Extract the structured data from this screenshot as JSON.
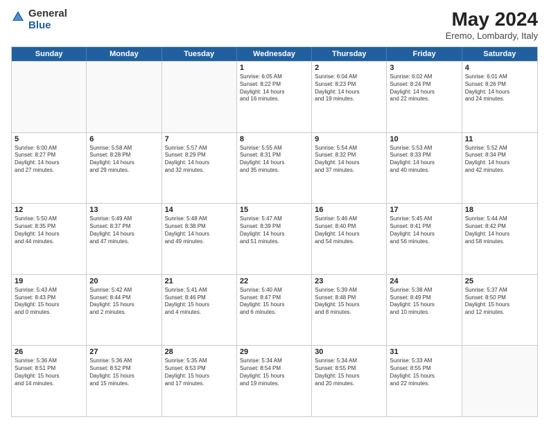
{
  "logo": {
    "general": "General",
    "blue": "Blue"
  },
  "title": "May 2024",
  "subtitle": "Eremo, Lombardy, Italy",
  "header_days": [
    "Sunday",
    "Monday",
    "Tuesday",
    "Wednesday",
    "Thursday",
    "Friday",
    "Saturday"
  ],
  "rows": [
    [
      {
        "day": "",
        "info": ""
      },
      {
        "day": "",
        "info": ""
      },
      {
        "day": "",
        "info": ""
      },
      {
        "day": "1",
        "info": "Sunrise: 6:05 AM\nSunset: 8:22 PM\nDaylight: 14 hours\nand 16 minutes."
      },
      {
        "day": "2",
        "info": "Sunrise: 6:04 AM\nSunset: 8:23 PM\nDaylight: 14 hours\nand 19 minutes."
      },
      {
        "day": "3",
        "info": "Sunrise: 6:02 AM\nSunset: 8:24 PM\nDaylight: 14 hours\nand 22 minutes."
      },
      {
        "day": "4",
        "info": "Sunrise: 6:01 AM\nSunset: 8:26 PM\nDaylight: 14 hours\nand 24 minutes."
      }
    ],
    [
      {
        "day": "5",
        "info": "Sunrise: 6:00 AM\nSunset: 8:27 PM\nDaylight: 14 hours\nand 27 minutes."
      },
      {
        "day": "6",
        "info": "Sunrise: 5:58 AM\nSunset: 8:28 PM\nDaylight: 14 hours\nand 29 minutes."
      },
      {
        "day": "7",
        "info": "Sunrise: 5:57 AM\nSunset: 8:29 PM\nDaylight: 14 hours\nand 32 minutes."
      },
      {
        "day": "8",
        "info": "Sunrise: 5:55 AM\nSunset: 8:31 PM\nDaylight: 14 hours\nand 35 minutes."
      },
      {
        "day": "9",
        "info": "Sunrise: 5:54 AM\nSunset: 8:32 PM\nDaylight: 14 hours\nand 37 minutes."
      },
      {
        "day": "10",
        "info": "Sunrise: 5:53 AM\nSunset: 8:33 PM\nDaylight: 14 hours\nand 40 minutes."
      },
      {
        "day": "11",
        "info": "Sunrise: 5:52 AM\nSunset: 8:34 PM\nDaylight: 14 hours\nand 42 minutes."
      }
    ],
    [
      {
        "day": "12",
        "info": "Sunrise: 5:50 AM\nSunset: 8:35 PM\nDaylight: 14 hours\nand 44 minutes."
      },
      {
        "day": "13",
        "info": "Sunrise: 5:49 AM\nSunset: 8:37 PM\nDaylight: 14 hours\nand 47 minutes."
      },
      {
        "day": "14",
        "info": "Sunrise: 5:48 AM\nSunset: 8:38 PM\nDaylight: 14 hours\nand 49 minutes."
      },
      {
        "day": "15",
        "info": "Sunrise: 5:47 AM\nSunset: 8:39 PM\nDaylight: 14 hours\nand 51 minutes."
      },
      {
        "day": "16",
        "info": "Sunrise: 5:46 AM\nSunset: 8:40 PM\nDaylight: 14 hours\nand 54 minutes."
      },
      {
        "day": "17",
        "info": "Sunrise: 5:45 AM\nSunset: 8:41 PM\nDaylight: 14 hours\nand 56 minutes."
      },
      {
        "day": "18",
        "info": "Sunrise: 5:44 AM\nSunset: 8:42 PM\nDaylight: 14 hours\nand 58 minutes."
      }
    ],
    [
      {
        "day": "19",
        "info": "Sunrise: 5:43 AM\nSunset: 8:43 PM\nDaylight: 15 hours\nand 0 minutes."
      },
      {
        "day": "20",
        "info": "Sunrise: 5:42 AM\nSunset: 8:44 PM\nDaylight: 15 hours\nand 2 minutes."
      },
      {
        "day": "21",
        "info": "Sunrise: 5:41 AM\nSunset: 8:46 PM\nDaylight: 15 hours\nand 4 minutes."
      },
      {
        "day": "22",
        "info": "Sunrise: 5:40 AM\nSunset: 8:47 PM\nDaylight: 15 hours\nand 6 minutes."
      },
      {
        "day": "23",
        "info": "Sunrise: 5:39 AM\nSunset: 8:48 PM\nDaylight: 15 hours\nand 8 minutes."
      },
      {
        "day": "24",
        "info": "Sunrise: 5:38 AM\nSunset: 8:49 PM\nDaylight: 15 hours\nand 10 minutes."
      },
      {
        "day": "25",
        "info": "Sunrise: 5:37 AM\nSunset: 8:50 PM\nDaylight: 15 hours\nand 12 minutes."
      }
    ],
    [
      {
        "day": "26",
        "info": "Sunrise: 5:36 AM\nSunset: 8:51 PM\nDaylight: 15 hours\nand 14 minutes."
      },
      {
        "day": "27",
        "info": "Sunrise: 5:36 AM\nSunset: 8:52 PM\nDaylight: 15 hours\nand 15 minutes."
      },
      {
        "day": "28",
        "info": "Sunrise: 5:35 AM\nSunset: 8:53 PM\nDaylight: 15 hours\nand 17 minutes."
      },
      {
        "day": "29",
        "info": "Sunrise: 5:34 AM\nSunset: 8:54 PM\nDaylight: 15 hours\nand 19 minutes."
      },
      {
        "day": "30",
        "info": "Sunrise: 5:34 AM\nSunset: 8:55 PM\nDaylight: 15 hours\nand 20 minutes."
      },
      {
        "day": "31",
        "info": "Sunrise: 5:33 AM\nSunset: 8:55 PM\nDaylight: 15 hours\nand 22 minutes."
      },
      {
        "day": "",
        "info": ""
      }
    ]
  ]
}
